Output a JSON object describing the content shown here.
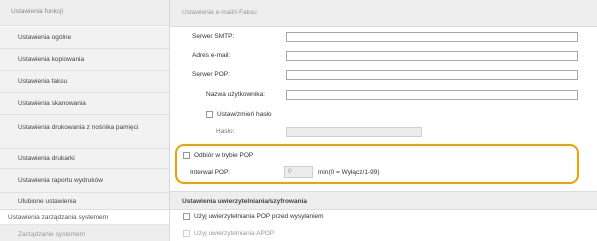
{
  "sidebar": {
    "header": "Ustawienia funkcji",
    "items": [
      {
        "label": "Ustawienia ogólne"
      },
      {
        "label": "Ustawienia kopiowania"
      },
      {
        "label": "Ustawienia faksu"
      },
      {
        "label": "Ustawienia skanowania"
      },
      {
        "label": "Ustawienia drukowania z nośnika pamięci"
      },
      {
        "label": "Ustawienia drukarki"
      },
      {
        "label": "Ustawienia raportu wydruków"
      },
      {
        "label": "Ulubione ustawienia"
      }
    ],
    "section": "Ustawienia zarządzania systemem",
    "subitem": "Zarządzanie systemem"
  },
  "main": {
    "header": "Ustawienia e-mail/I-Faksu",
    "fields": {
      "smtp_label": "Serwer SMTP:",
      "smtp_value": "",
      "email_label": "Adres e-mail:",
      "email_value": "",
      "pop_label": "Serwer POP:",
      "pop_value": "",
      "username_label": "Nazwa użytkownika:",
      "username_value": "",
      "set_password_label": "Ustaw/zmień hasło",
      "password_label": "Hasło:"
    },
    "pop_receive": {
      "checkbox_label": "Odbiór w trybie POP",
      "interval_label": "Interwał POP:",
      "interval_value": "0",
      "interval_hint": "min(0 = Wyłącz/1-99)"
    },
    "auth_section": {
      "header": "Ustawienia uwierzytelniania/szyfrowania",
      "option1": "Użyj uwierzytelniania POP przed wysyłaniem",
      "option2": "Użyj uwierzytelniania APOP"
    }
  },
  "colors": {
    "highlight": "#f0a000"
  }
}
